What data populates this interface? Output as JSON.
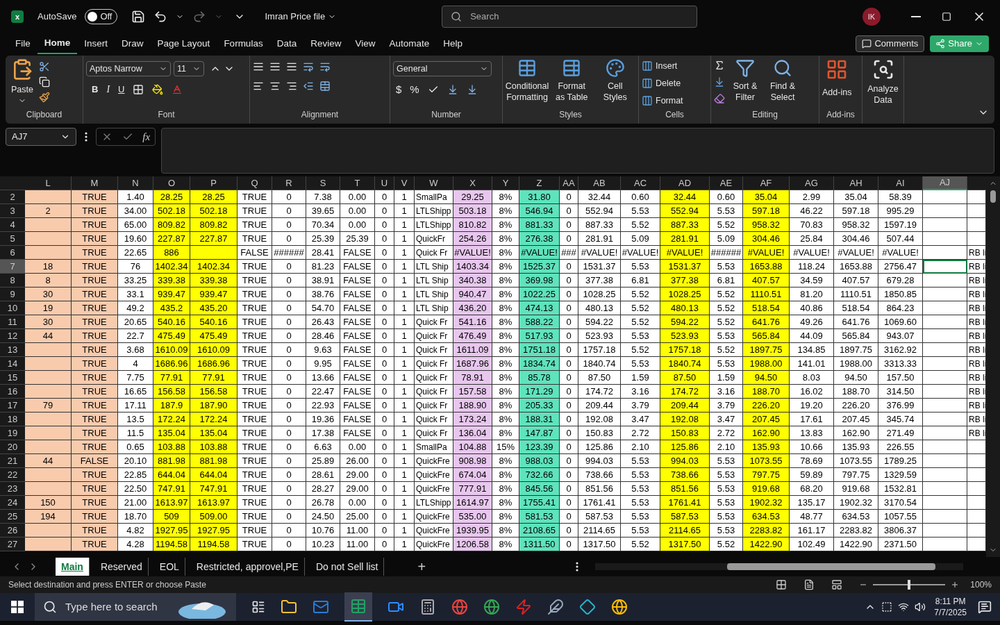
{
  "title_bar": {
    "app_logo": "x",
    "autosave_label": "AutoSave",
    "autosave": {
      "on": false,
      "label": "Off"
    },
    "file_name": "Imran Price file",
    "search_placeholder": "Search",
    "avatar": "IK"
  },
  "menu_tabs": [
    {
      "label": "File",
      "selected": false
    },
    {
      "label": "Home",
      "selected": true
    },
    {
      "label": "Insert",
      "selected": false
    },
    {
      "label": "Draw",
      "selected": false
    },
    {
      "label": "Page Layout",
      "selected": false
    },
    {
      "label": "Formulas",
      "selected": false
    },
    {
      "label": "Data",
      "selected": false
    },
    {
      "label": "Review",
      "selected": false
    },
    {
      "label": "View",
      "selected": false
    },
    {
      "label": "Automate",
      "selected": false
    },
    {
      "label": "Help",
      "selected": false
    }
  ],
  "comments_button": "Comments",
  "share_button": "Share",
  "ribbon": {
    "clipboard": {
      "label": "Clipboard",
      "paste": "Paste"
    },
    "font": {
      "label": "Font",
      "font_name": "Aptos Narrow",
      "font_size": "11",
      "bold": "B",
      "italic": "I",
      "underline": "U"
    },
    "alignment": {
      "label": "Alignment"
    },
    "number": {
      "label": "Number",
      "format": "General",
      "currency": "$",
      "percent": "%"
    },
    "styles": {
      "label": "Styles",
      "buttons": [
        "Conditional Formatting",
        "Format as Table",
        "Cell Styles"
      ]
    },
    "cells": {
      "label": "Cells",
      "buttons": [
        "Insert",
        "Delete",
        "Format"
      ]
    },
    "editing": {
      "label": "Editing",
      "buttons": [
        "Sort & Filter",
        "Find & Select"
      ]
    },
    "addins": {
      "label": "Add-ins",
      "buttons": [
        "Add-ins"
      ]
    },
    "analyze": {
      "buttons": [
        "Analyze Data"
      ]
    }
  },
  "formula_bar": {
    "name_box": "AJ7",
    "function_label": "fx"
  },
  "columns": [
    {
      "label": "L",
      "selected": false,
      "color": "#f8cbad"
    },
    {
      "label": "M",
      "selected": false,
      "color": "#f8cbad"
    },
    {
      "label": "N",
      "selected": false
    },
    {
      "label": "O",
      "selected": false,
      "color": "#ffff00"
    },
    {
      "label": "P",
      "selected": false,
      "color": "#ffff00"
    },
    {
      "label": "Q",
      "selected": false
    },
    {
      "label": "R",
      "selected": false
    },
    {
      "label": "S",
      "selected": false
    },
    {
      "label": "T",
      "selected": false
    },
    {
      "label": "U",
      "selected": false
    },
    {
      "label": "V",
      "selected": false
    },
    {
      "label": "W",
      "selected": false,
      "kind": "text"
    },
    {
      "label": "X",
      "selected": false,
      "color": "#e8c7ee"
    },
    {
      "label": "Y",
      "selected": false
    },
    {
      "label": "Z",
      "selected": false,
      "color": "#5fe3bc"
    },
    {
      "label": "AA",
      "selected": false
    },
    {
      "label": "AB",
      "selected": false
    },
    {
      "label": "AC",
      "selected": false
    },
    {
      "label": "AD",
      "selected": false,
      "color": "#ffff00"
    },
    {
      "label": "AE",
      "selected": false
    },
    {
      "label": "AF",
      "selected": false,
      "color": "#ffff00"
    },
    {
      "label": "AG",
      "selected": false
    },
    {
      "label": "AH",
      "selected": false
    },
    {
      "label": "AI",
      "selected": false
    },
    {
      "label": "AJ",
      "selected": true
    },
    {
      "kind": "text"
    }
  ],
  "rows": [
    {
      "number": "2",
      "selected": false,
      "cells": [
        null,
        "TRUE",
        "1.40",
        "28.25",
        "28.25",
        "TRUE",
        "0",
        "7.38",
        "0.00",
        "0",
        "1",
        "SmallPa",
        "29.25",
        "8%",
        "31.80",
        "0",
        "32.44",
        "0.60",
        "32.44",
        "0.60",
        "35.04",
        "2.99",
        "35.04",
        "58.39",
        null,
        null
      ]
    },
    {
      "number": "3",
      "selected": false,
      "cells": [
        "2",
        "TRUE",
        "34.00",
        "502.18",
        "502.18",
        "TRUE",
        "0",
        "39.65",
        "0.00",
        "0",
        "1",
        "LTLShipp",
        "503.18",
        "8%",
        "546.94",
        "0",
        "552.94",
        "5.53",
        "552.94",
        "5.53",
        "597.18",
        "46.22",
        "597.18",
        "995.29",
        null,
        null
      ]
    },
    {
      "number": "4",
      "selected": false,
      "cells": [
        null,
        "TRUE",
        "65.00",
        "809.82",
        "809.82",
        "TRUE",
        "0",
        "70.34",
        "0.00",
        "0",
        "1",
        "LTLShipp",
        "810.82",
        "8%",
        "881.33",
        "0",
        "887.33",
        "5.52",
        "887.33",
        "5.52",
        "958.32",
        "70.83",
        "958.32",
        "1597.19",
        null,
        null
      ]
    },
    {
      "number": "5",
      "selected": false,
      "cells": [
        null,
        "TRUE",
        "19.60",
        "227.87",
        "227.87",
        "TRUE",
        "0",
        "25.39",
        "25.39",
        "0",
        "1",
        "QuickFr",
        "254.26",
        "8%",
        "276.38",
        "0",
        "281.91",
        "5.09",
        "281.91",
        "5.09",
        "304.46",
        "25.84",
        "304.46",
        "507.44",
        null,
        null
      ]
    },
    {
      "number": "6",
      "selected": false,
      "cells": [
        null,
        "TRUE",
        "22.65",
        "886",
        null,
        "FALSE",
        "######",
        "28.41",
        "FALSE",
        "0",
        "1",
        "Quick Fr",
        "#VALUE!",
        "8%",
        "#VALUE!",
        "###",
        "#VALUE!",
        "#VALUE!",
        "#VALUE!",
        "######",
        "#VALUE!",
        "#VALUE!",
        "#VALUE!",
        "#VALUE!",
        null,
        "RB li"
      ]
    },
    {
      "number": "7",
      "selected": true,
      "cells": [
        "18",
        "TRUE",
        "76",
        "1402.34",
        "1402.34",
        "TRUE",
        "0",
        "81.23",
        "FALSE",
        "0",
        "1",
        "LTL Ship",
        "1403.34",
        "8%",
        "1525.37",
        "0",
        "1531.37",
        "5.53",
        "1531.37",
        "5.53",
        "1653.88",
        "118.24",
        "1653.88",
        "2756.47",
        null,
        "RB li"
      ]
    },
    {
      "number": "8",
      "selected": false,
      "cells": [
        "8",
        "TRUE",
        "33.25",
        "339.38",
        "339.38",
        "TRUE",
        "0",
        "38.91",
        "FALSE",
        "0",
        "1",
        "LTL Ship",
        "340.38",
        "8%",
        "369.98",
        "0",
        "377.38",
        "6.81",
        "377.38",
        "6.81",
        "407.57",
        "34.59",
        "407.57",
        "679.28",
        null,
        "RB li"
      ]
    },
    {
      "number": "9",
      "selected": false,
      "cells": [
        "30",
        "TRUE",
        "33.1",
        "939.47",
        "939.47",
        "TRUE",
        "0",
        "38.76",
        "FALSE",
        "0",
        "1",
        "LTL Ship",
        "940.47",
        "8%",
        "1022.25",
        "0",
        "1028.25",
        "5.52",
        "1028.25",
        "5.52",
        "1110.51",
        "81.20",
        "1110.51",
        "1850.85",
        null,
        "RB li"
      ]
    },
    {
      "number": "10",
      "selected": false,
      "cells": [
        "19",
        "TRUE",
        "49.2",
        "435.2",
        "435.20",
        "TRUE",
        "0",
        "54.70",
        "FALSE",
        "0",
        "1",
        "LTL Ship",
        "436.20",
        "8%",
        "474.13",
        "0",
        "480.13",
        "5.52",
        "480.13",
        "5.52",
        "518.54",
        "40.86",
        "518.54",
        "864.23",
        null,
        "RB li"
      ]
    },
    {
      "number": "11",
      "selected": false,
      "cells": [
        "30",
        "TRUE",
        "20.65",
        "540.16",
        "540.16",
        "TRUE",
        "0",
        "26.43",
        "FALSE",
        "0",
        "1",
        "Quick Fr",
        "541.16",
        "8%",
        "588.22",
        "0",
        "594.22",
        "5.52",
        "594.22",
        "5.52",
        "641.76",
        "49.26",
        "641.76",
        "1069.60",
        null,
        "RB li"
      ]
    },
    {
      "number": "12",
      "selected": false,
      "cells": [
        "44",
        "TRUE",
        "22.7",
        "475.49",
        "475.49",
        "TRUE",
        "0",
        "28.46",
        "FALSE",
        "0",
        "1",
        "Quick Fr",
        "476.49",
        "8%",
        "517.93",
        "0",
        "523.93",
        "5.53",
        "523.93",
        "5.53",
        "565.84",
        "44.09",
        "565.84",
        "943.07",
        null,
        "RB li"
      ]
    },
    {
      "number": "13",
      "selected": false,
      "cells": [
        null,
        "TRUE",
        "3.68",
        "1610.09",
        "1610.09",
        "TRUE",
        "0",
        "9.63",
        "FALSE",
        "0",
        "1",
        "Quick Fr",
        "1611.09",
        "8%",
        "1751.18",
        "0",
        "1757.18",
        "5.52",
        "1757.18",
        "5.52",
        "1897.75",
        "134.85",
        "1897.75",
        "3162.92",
        null,
        "RB li"
      ]
    },
    {
      "number": "14",
      "selected": false,
      "cells": [
        null,
        "TRUE",
        "4",
        "1686.96",
        "1686.96",
        "TRUE",
        "0",
        "9.95",
        "FALSE",
        "0",
        "1",
        "Quick Fr",
        "1687.96",
        "8%",
        "1834.74",
        "0",
        "1840.74",
        "5.53",
        "1840.74",
        "5.53",
        "1988.00",
        "141.01",
        "1988.00",
        "3313.33",
        null,
        "RB li"
      ]
    },
    {
      "number": "15",
      "selected": false,
      "cells": [
        null,
        "TRUE",
        "7.75",
        "77.91",
        "77.91",
        "TRUE",
        "0",
        "13.66",
        "FALSE",
        "0",
        "1",
        "Quick Fr",
        "78.91",
        "8%",
        "85.78",
        "0",
        "87.50",
        "1.59",
        "87.50",
        "1.59",
        "94.50",
        "8.03",
        "94.50",
        "157.50",
        null,
        "RB li"
      ]
    },
    {
      "number": "16",
      "selected": false,
      "cells": [
        null,
        "TRUE",
        "16.65",
        "156.58",
        "156.58",
        "TRUE",
        "0",
        "22.47",
        "FALSE",
        "0",
        "1",
        "Quick Fr",
        "157.58",
        "8%",
        "171.29",
        "0",
        "174.72",
        "3.16",
        "174.72",
        "3.16",
        "188.70",
        "16.02",
        "188.70",
        "314.50",
        null,
        "RB li"
      ]
    },
    {
      "number": "17",
      "selected": false,
      "cells": [
        "79",
        "TRUE",
        "17.11",
        "187.9",
        "187.90",
        "TRUE",
        "0",
        "22.93",
        "FALSE",
        "0",
        "1",
        "Quick Fr",
        "188.90",
        "8%",
        "205.33",
        "0",
        "209.44",
        "3.79",
        "209.44",
        "3.79",
        "226.20",
        "19.20",
        "226.20",
        "376.99",
        null,
        "RB li"
      ]
    },
    {
      "number": "18",
      "selected": false,
      "cells": [
        null,
        "TRUE",
        "13.5",
        "172.24",
        "172.24",
        "TRUE",
        "0",
        "19.36",
        "FALSE",
        "0",
        "1",
        "Quick Fr",
        "173.24",
        "8%",
        "188.31",
        "0",
        "192.08",
        "3.47",
        "192.08",
        "3.47",
        "207.45",
        "17.61",
        "207.45",
        "345.74",
        null,
        "RB li"
      ]
    },
    {
      "number": "19",
      "selected": false,
      "cells": [
        null,
        "TRUE",
        "11.5",
        "135.04",
        "135.04",
        "TRUE",
        "0",
        "17.38",
        "FALSE",
        "0",
        "1",
        "Quick Fr",
        "136.04",
        "8%",
        "147.87",
        "0",
        "150.83",
        "2.72",
        "150.83",
        "2.72",
        "162.90",
        "13.83",
        "162.90",
        "271.49",
        null,
        "RB li"
      ]
    },
    {
      "number": "20",
      "selected": false,
      "cells": [
        null,
        "TRUE",
        "0.65",
        "103.88",
        "103.88",
        "TRUE",
        "0",
        "6.63",
        "0.00",
        "0",
        "1",
        "SmallPa",
        "104.88",
        "15%",
        "123.39",
        "0",
        "125.86",
        "2.10",
        "125.86",
        "2.10",
        "135.93",
        "10.66",
        "135.93",
        "226.55",
        null,
        null
      ]
    },
    {
      "number": "21",
      "selected": false,
      "cells": [
        "44",
        "FALSE",
        "20.10",
        "881.98",
        "881.98",
        "TRUE",
        "0",
        "25.89",
        "26.00",
        "0",
        "1",
        "QuickFre",
        "908.98",
        "8%",
        "988.03",
        "0",
        "994.03",
        "5.53",
        "994.03",
        "5.53",
        "1073.55",
        "78.69",
        "1073.55",
        "1789.25",
        null,
        null
      ]
    },
    {
      "number": "22",
      "selected": false,
      "cells": [
        null,
        "TRUE",
        "22.85",
        "644.04",
        "644.04",
        "TRUE",
        "0",
        "28.61",
        "29.00",
        "0",
        "1",
        "QuickFre",
        "674.04",
        "8%",
        "732.66",
        "0",
        "738.66",
        "5.53",
        "738.66",
        "5.53",
        "797.75",
        "59.89",
        "797.75",
        "1329.59",
        null,
        null
      ]
    },
    {
      "number": "23",
      "selected": false,
      "cells": [
        null,
        "TRUE",
        "22.50",
        "747.91",
        "747.91",
        "TRUE",
        "0",
        "28.27",
        "29.00",
        "0",
        "1",
        "QuickFre",
        "777.91",
        "8%",
        "845.56",
        "0",
        "851.56",
        "5.53",
        "851.56",
        "5.53",
        "919.68",
        "68.20",
        "919.68",
        "1532.81",
        null,
        null
      ]
    },
    {
      "number": "24",
      "selected": false,
      "cells": [
        "150",
        "TRUE",
        "21.00",
        "1613.97",
        "1613.97",
        "TRUE",
        "0",
        "26.78",
        "0.00",
        "0",
        "1",
        "LTLShipp",
        "1614.97",
        "8%",
        "1755.41",
        "0",
        "1761.41",
        "5.53",
        "1761.41",
        "5.53",
        "1902.32",
        "135.17",
        "1902.32",
        "3170.54",
        null,
        null
      ]
    },
    {
      "number": "25",
      "selected": false,
      "cells": [
        "194",
        "TRUE",
        "18.70",
        "509",
        "509.00",
        "TRUE",
        "0",
        "24.50",
        "25.00",
        "0",
        "1",
        "QuickFre",
        "535.00",
        "8%",
        "581.53",
        "0",
        "587.53",
        "5.53",
        "587.53",
        "5.53",
        "634.53",
        "48.77",
        "634.53",
        "1057.55",
        null,
        null
      ]
    },
    {
      "number": "26",
      "selected": false,
      "cells": [
        null,
        "TRUE",
        "4.82",
        "1927.95",
        "1927.95",
        "TRUE",
        "0",
        "10.76",
        "11.00",
        "0",
        "1",
        "QuickFre",
        "1939.95",
        "8%",
        "2108.65",
        "0",
        "2114.65",
        "5.53",
        "2114.65",
        "5.53",
        "2283.82",
        "161.17",
        "2283.82",
        "3806.37",
        null,
        null
      ]
    },
    {
      "number": "27",
      "selected": false,
      "cells": [
        null,
        "TRUE",
        "4.28",
        "1194.58",
        "1194.58",
        "TRUE",
        "0",
        "10.23",
        "11.00",
        "0",
        "1",
        "QuickFre",
        "1206.58",
        "8%",
        "1311.50",
        "0",
        "1317.50",
        "5.52",
        "1317.50",
        "5.52",
        "1422.90",
        "102.49",
        "1422.90",
        "2371.50",
        null,
        null
      ]
    }
  ],
  "sheet_tabs": [
    {
      "label": "Main",
      "selected": true
    },
    {
      "label": "Reserved",
      "selected": false
    },
    {
      "label": "EOL",
      "selected": false
    },
    {
      "label": "Restricted, approvel,PE",
      "selected": false
    },
    {
      "label": "Do not Sell list",
      "selected": false
    }
  ],
  "add_sheet": "+",
  "status_bar": {
    "message": "Select destination and press ENTER or choose Paste",
    "zoom": {
      "level": 0.5
    },
    "zoom_label": "100%"
  },
  "taskbar": {
    "search_placeholder": "Type here to search",
    "time": "8:11 PM",
    "date": "7/7/2025"
  }
}
